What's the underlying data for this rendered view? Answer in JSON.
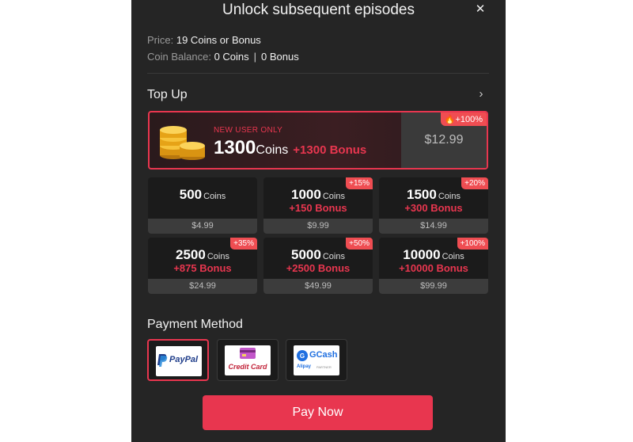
{
  "modal": {
    "title": "Unlock subsequent episodes",
    "close_icon": "close-icon"
  },
  "info": {
    "price_label": "Price:",
    "price_value": "19 Coins or Bonus",
    "balance_label": "Coin Balance:",
    "coins_value": "0 Coins",
    "separator": "|",
    "bonus_value": "0 Bonus"
  },
  "top_up": {
    "title": "Top Up",
    "chevron_icon": "chevron-right-icon",
    "promo": {
      "tag": "NEW USER ONLY",
      "amount": "1300",
      "unit": "Coins",
      "bonus": "+1300 Bonus",
      "price": "$12.99",
      "badge": "+100%",
      "badge_icon": "fire-icon",
      "icon": "coins-stack-icon"
    },
    "packages": [
      {
        "amount": "500",
        "unit": "Coins",
        "bonus": "",
        "price": "$4.99",
        "badge": ""
      },
      {
        "amount": "1000",
        "unit": "Coins",
        "bonus": "+150 Bonus",
        "price": "$9.99",
        "badge": "+15%"
      },
      {
        "amount": "1500",
        "unit": "Coins",
        "bonus": "+300 Bonus",
        "price": "$14.99",
        "badge": "+20%"
      },
      {
        "amount": "2500",
        "unit": "Coins",
        "bonus": "+875 Bonus",
        "price": "$24.99",
        "badge": "+35%"
      },
      {
        "amount": "5000",
        "unit": "Coins",
        "bonus": "+2500 Bonus",
        "price": "$49.99",
        "badge": "+50%"
      },
      {
        "amount": "10000",
        "unit": "Coins",
        "bonus": "+10000 Bonus",
        "price": "$99.99",
        "badge": "+100%"
      }
    ]
  },
  "payment": {
    "title": "Payment Method",
    "methods": [
      {
        "name": "PayPal",
        "selected": true
      },
      {
        "name": "Credit Card",
        "selected": false
      },
      {
        "name": "GCash",
        "sub": "Alipay",
        "sub2": "PARTNER",
        "selected": false
      }
    ]
  },
  "pay_button": "Pay Now",
  "colors": {
    "accent": "#e8364f",
    "background": "#252525",
    "card": "#1b1b1b",
    "badge": "#ef4d52"
  }
}
